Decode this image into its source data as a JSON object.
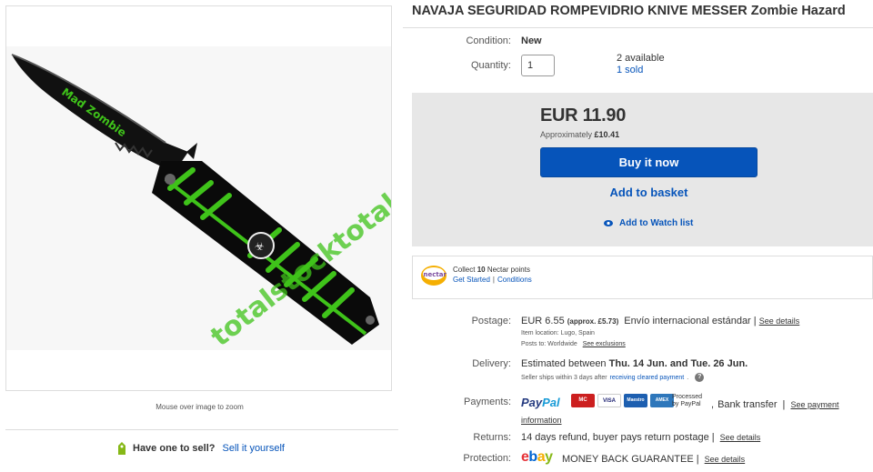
{
  "image": {
    "zoom_hint": "Mouse over image to zoom",
    "watermark": "totalstocktotal",
    "blade_text": "Mad Zombie"
  },
  "sell": {
    "question": "Have one to sell?",
    "link": "Sell it yourself"
  },
  "listing": {
    "title": "NAVAJA SEGURIDAD ROMPEVIDRIO KNIVE MESSER Zombie Hazard",
    "condition_label": "Condition:",
    "condition_value": "New",
    "quantity_label": "Quantity:",
    "quantity_value": "1",
    "available": "2 available",
    "sold": "1 sold"
  },
  "buy_box": {
    "price": "EUR 11.90",
    "approx_label": "Approximately",
    "approx_value": "£10.41",
    "buy_now": "Buy it now",
    "add_basket": "Add to basket",
    "watch": "Add to Watch list"
  },
  "nectar": {
    "logo_text": "nectar",
    "collect_prefix": "Collect",
    "points": "10",
    "collect_suffix": "Nectar points",
    "get_started": "Get Started",
    "separator": "|",
    "conditions": "Conditions"
  },
  "postage": {
    "label": "Postage:",
    "price": "EUR 6.55",
    "approx": "(approx. £5.73)",
    "service": "Envío internacional estándar",
    "sep": "|",
    "see_details": "See details",
    "item_location": "Item location:  Lugo, Spain",
    "posts_to_label": "Posts to:  Worldwide",
    "see_exclusions": "See exclusions"
  },
  "delivery": {
    "label": "Delivery:",
    "estimated_prefix": "Estimated between",
    "dates": "Thu. 14 Jun. and Tue. 26 Jun.",
    "ships_prefix": "Seller ships within 3 days after",
    "ships_link": "receiving cleared payment",
    "ships_suffix": ".",
    "info_icon": "?"
  },
  "payments": {
    "label": "Payments:",
    "paypal_1": "Pay",
    "paypal_2": "Pal",
    "card_mastercard": "MC",
    "card_visa": "VISA",
    "card_maestro": "Maestro",
    "card_amex": "AMEX",
    "processed_1": "Processed",
    "processed_2": "by PayPal",
    "bank_transfer": "Bank transfer",
    "sep": "|",
    "see_payment": "See payment",
    "information": "information"
  },
  "returns": {
    "label": "Returns:",
    "text": "14 days refund, buyer pays return postage",
    "sep": "|",
    "see_details": "See details"
  },
  "protection": {
    "label": "Protection:",
    "ebay_e": "e",
    "ebay_b": "b",
    "ebay_a": "a",
    "ebay_y": "y",
    "guarantee": "MONEY BACK GUARANTEE",
    "sep": "|",
    "see_details": "See details"
  },
  "colors": {
    "link": "#0654ba",
    "buy_button": "#0654ba",
    "box_bg": "#e7e7e7",
    "knife_green": "#3fc31a"
  }
}
